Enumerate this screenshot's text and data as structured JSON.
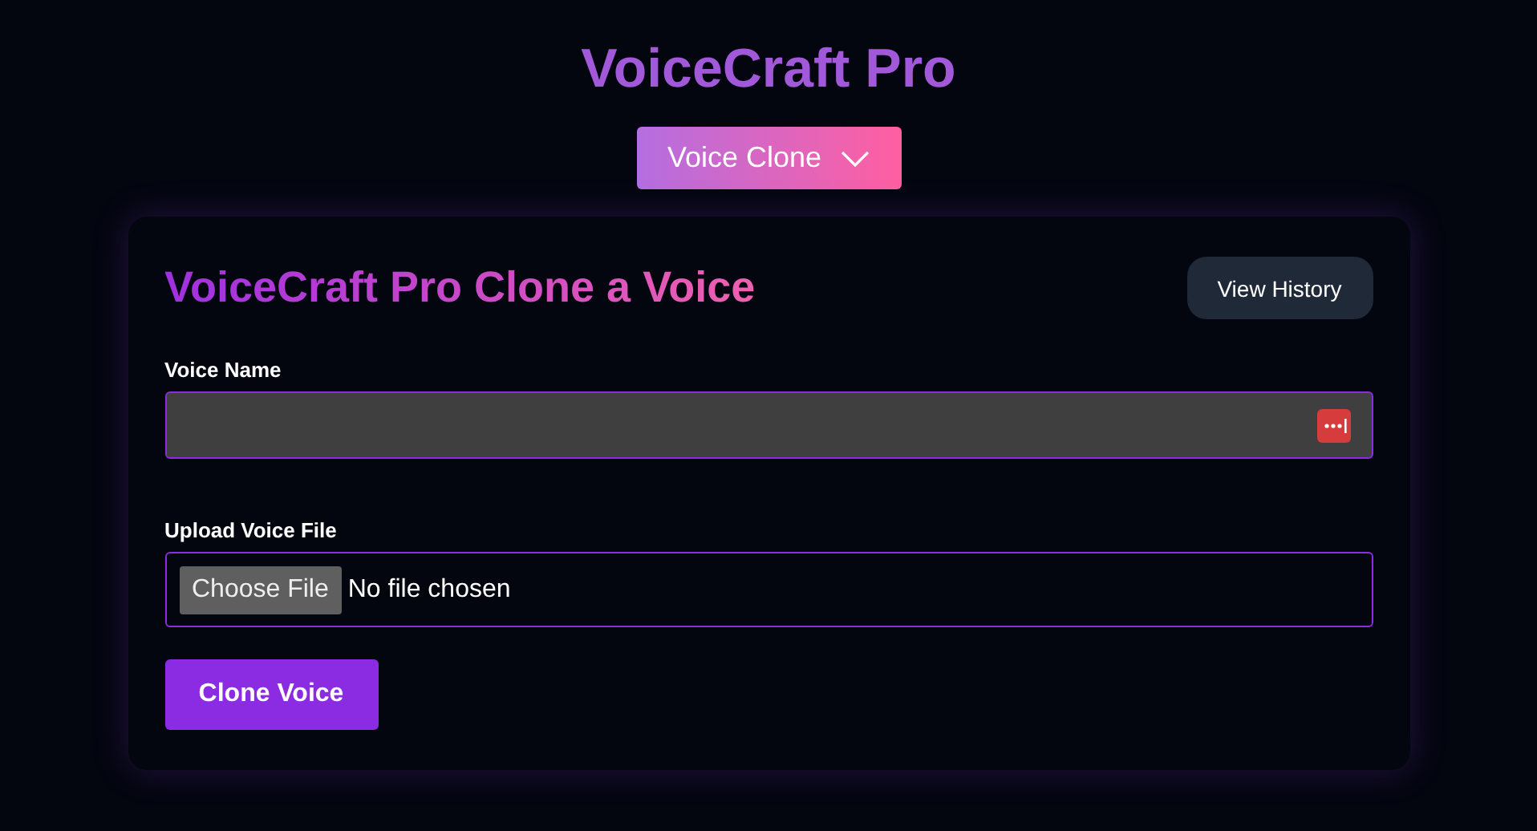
{
  "app_title": "VoiceCraft Pro",
  "mode_dropdown": {
    "label": "Voice Clone"
  },
  "card": {
    "heading": "VoiceCraft Pro Clone a Voice",
    "history_button": "View History",
    "voice_name": {
      "label": "Voice Name"
    },
    "upload": {
      "label": "Upload Voice File",
      "button": "Choose File",
      "status": "No file chosen"
    },
    "submit_button": "Clone Voice"
  }
}
